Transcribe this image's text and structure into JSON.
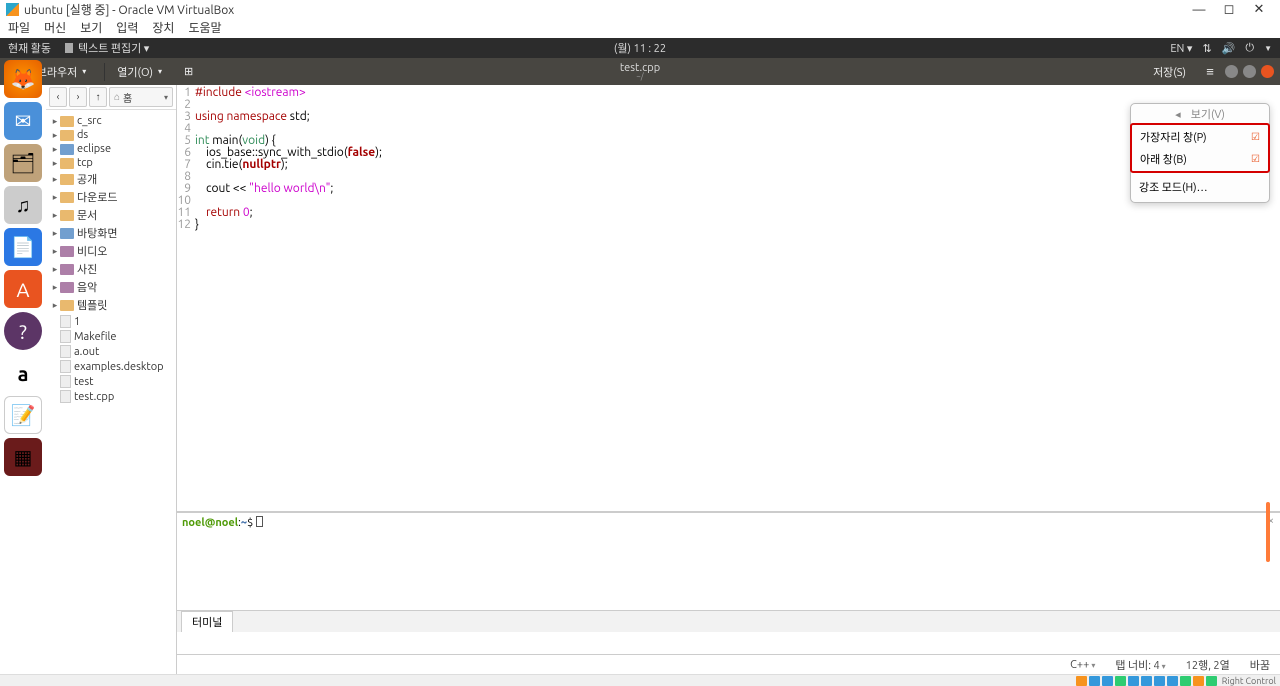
{
  "vb": {
    "title": "ubuntu [실행 중] - Oracle VM VirtualBox",
    "menu": [
      "파일",
      "머신",
      "보기",
      "입력",
      "장치",
      "도움말"
    ],
    "status_host": "Right Control"
  },
  "ubuntu_top": {
    "activities": "현재 활동",
    "app": "텍스트 편집기 ▾",
    "clock": "(월)  11 : 22",
    "lang": "EN ▾"
  },
  "gedit": {
    "file_browser": "파일 브라우저",
    "open": "열기(O)",
    "title": "test.cpp",
    "subtitle": "~/",
    "save": "저장(S)"
  },
  "nav": {
    "back": "‹",
    "fwd": "›",
    "up": "↑",
    "home": "홈"
  },
  "tree": [
    {
      "exp": "▸",
      "t": "folder",
      "label": "c_src"
    },
    {
      "exp": "▸",
      "t": "folder",
      "label": "ds"
    },
    {
      "exp": "▸",
      "t": "folder blue",
      "label": "eclipse"
    },
    {
      "exp": "▸",
      "t": "folder",
      "label": "tcp"
    },
    {
      "exp": "▸",
      "t": "folder",
      "label": "공개"
    },
    {
      "exp": "▸",
      "t": "folder",
      "label": "다운로드"
    },
    {
      "exp": "▸",
      "t": "folder",
      "label": "문서"
    },
    {
      "exp": "▸",
      "t": "folder blue",
      "label": "바탕화면"
    },
    {
      "exp": "▸",
      "t": "folder violet",
      "label": "비디오"
    },
    {
      "exp": "▸",
      "t": "folder violet",
      "label": "사진"
    },
    {
      "exp": "▸",
      "t": "folder violet",
      "label": "음악"
    },
    {
      "exp": "▸",
      "t": "folder",
      "label": "템플릿"
    },
    {
      "exp": "",
      "t": "file",
      "label": "1"
    },
    {
      "exp": "",
      "t": "file",
      "label": "Makefile"
    },
    {
      "exp": "",
      "t": "file",
      "label": "a.out"
    },
    {
      "exp": "",
      "t": "file",
      "label": "examples.desktop"
    },
    {
      "exp": "",
      "t": "file",
      "label": "test"
    },
    {
      "exp": "",
      "t": "file",
      "label": "test.cpp"
    }
  ],
  "code": {
    "lines": [
      "1",
      "2",
      "3",
      "4",
      "5",
      "6",
      "7",
      "8",
      "9",
      "10",
      "11",
      "12"
    ],
    "l1a": "#include ",
    "l1b": "<iostream>",
    "l3a": "using",
    "l3b": " namespace",
    "l3c": " std;",
    "l5a": "int",
    "l5b": " main(",
    "l5c": "void",
    "l5d": ") {",
    "l6a": "    ios_base::sync_with_stdio(",
    "l6b": "false",
    "l6c": ");",
    "l7a": "    cin.tie(",
    "l7b": "nullptr",
    "l7c": ");",
    "l9a": "    cout << ",
    "l9b": "\"hello world\\n\"",
    "l9c": ";",
    "l11a": "    ",
    "l11b": "return",
    "l11c": " ",
    "l11d": "0",
    "l11e": ";",
    "l12": "}"
  },
  "term": {
    "user": "noel@noel",
    "colon": ":",
    "path": "~",
    "dollar": "$ ",
    "tab": "터미널"
  },
  "status": {
    "lang": "C++",
    "tab": "탭 너비: 4",
    "pos": "12행, 2열",
    "ins": "바꿈"
  },
  "popup": {
    "view": "보기(V)",
    "side": "가장자리 창(P)",
    "bottom": "아래 창(B)",
    "highlight": "강조 모드(H)…"
  }
}
